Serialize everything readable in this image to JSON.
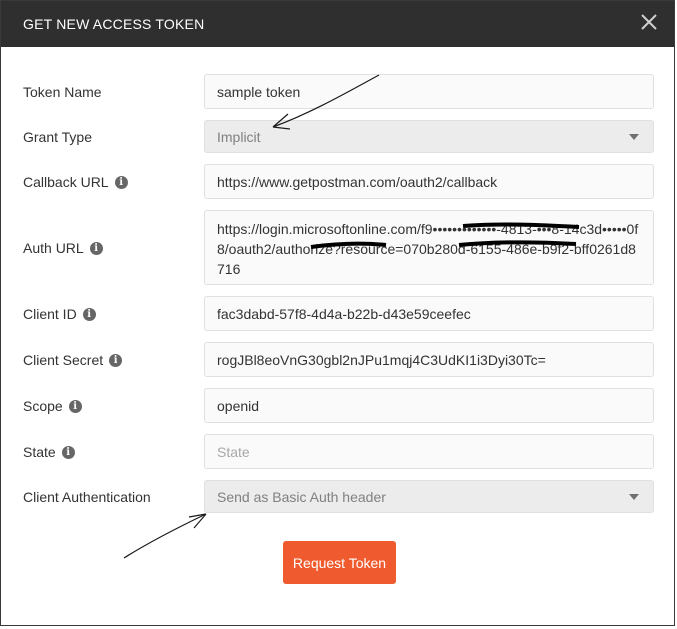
{
  "dialog": {
    "title": "GET NEW ACCESS TOKEN",
    "close_icon": "close-icon"
  },
  "fields": {
    "token_name": {
      "label": "Token Name",
      "value": "sample token"
    },
    "grant_type": {
      "label": "Grant Type",
      "value": "Implicit"
    },
    "callback_url": {
      "label": "Callback URL",
      "value": "https://www.getpostman.com/oauth2/callback"
    },
    "auth_url": {
      "label": "Auth URL",
      "value": "https://login.microsoftonline.com/f9•••••••••••••-4813-•••8-14c3d•••••0f8/oauth2/authorize?resource=070b280d-6155-486e-b9f2-bff0261d8716"
    },
    "client_id": {
      "label": "Client ID",
      "value": "fac3dabd-57f8-4d4a-b22b-d43e59ceefec"
    },
    "client_secret": {
      "label": "Client Secret",
      "value": "rogJBl8eoVnG30gbl2nJPu1mqj4C3UdKI1i3Dyi30Tc="
    },
    "scope": {
      "label": "Scope",
      "value": "openid"
    },
    "state": {
      "label": "State",
      "placeholder": "State"
    },
    "client_auth": {
      "label": "Client Authentication",
      "value": "Send as Basic Auth header"
    }
  },
  "actions": {
    "request_token": "Request Token"
  },
  "colors": {
    "titlebar": "#2f2f2f",
    "accent": "#ef5b2e"
  }
}
